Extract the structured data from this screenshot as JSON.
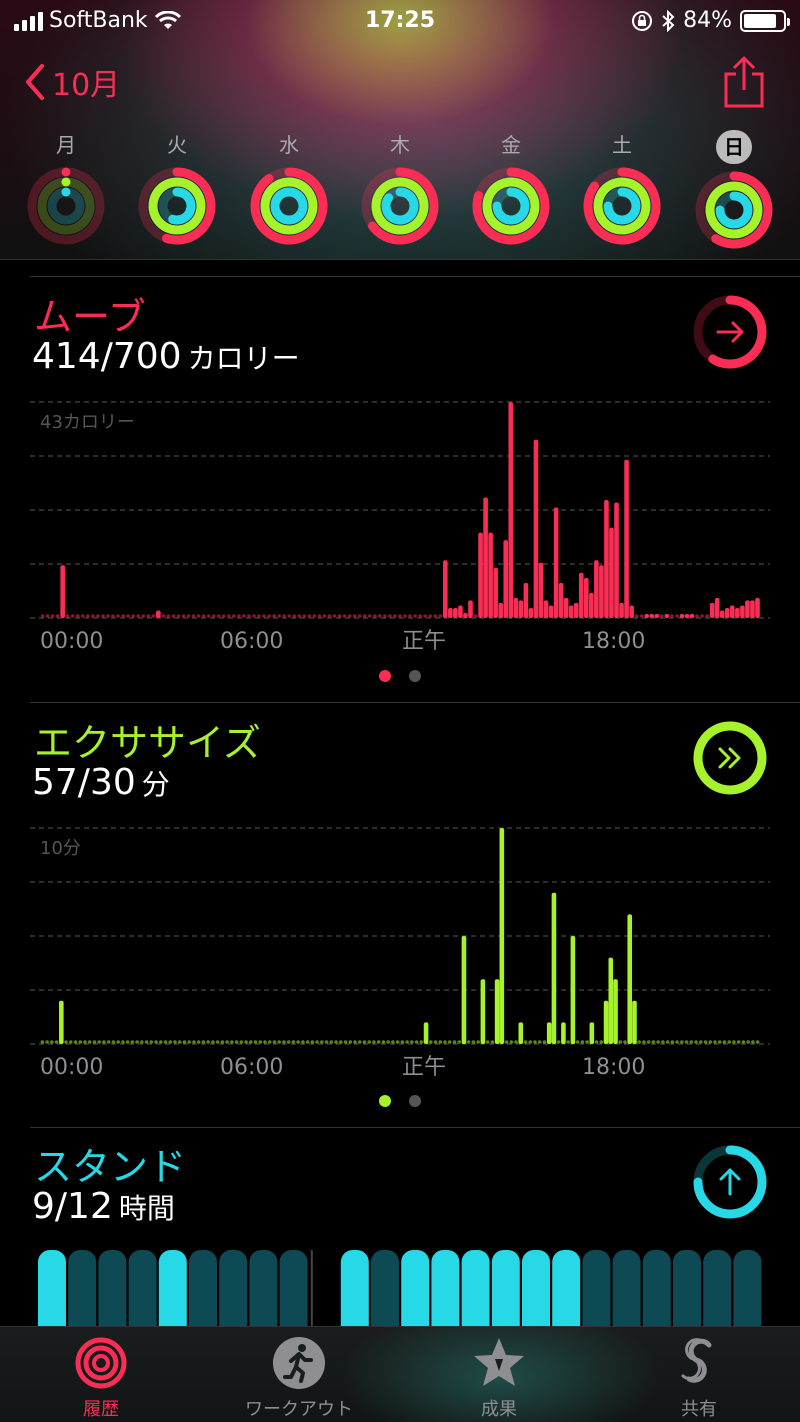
{
  "status": {
    "carrier": "SoftBank",
    "time": "17:25",
    "battery": "84%",
    "battery_level": 0.84
  },
  "nav": {
    "back_label": "10月"
  },
  "week": [
    {
      "label": "月",
      "move": 0.05,
      "exercise": 0.04,
      "stand": 0.06,
      "today": false
    },
    {
      "label": "火",
      "move": 0.55,
      "exercise": 1.0,
      "stand": 0.55,
      "today": false
    },
    {
      "label": "水",
      "move": 0.9,
      "exercise": 1.0,
      "stand": 1.0,
      "today": false
    },
    {
      "label": "木",
      "move": 0.65,
      "exercise": 1.0,
      "stand": 0.85,
      "today": false
    },
    {
      "label": "金",
      "move": 0.8,
      "exercise": 1.0,
      "stand": 0.75,
      "today": false
    },
    {
      "label": "土",
      "move": 0.85,
      "exercise": 1.0,
      "stand": 0.75,
      "today": false
    },
    {
      "label": "日",
      "move": 0.59,
      "exercise": 1.0,
      "stand": 0.75,
      "today": true
    }
  ],
  "colors": {
    "move": "#fa2e55",
    "exercise": "#a6f32c",
    "stand": "#27d8e6"
  },
  "move": {
    "title": "ムーブ",
    "value": "414/700",
    "unit": "カロリー",
    "progress": 0.59,
    "chart_data": {
      "type": "bar",
      "ylabel": "43カロリー",
      "ymax": 43,
      "x_ticks": [
        "00:00",
        "06:00",
        "正午",
        "18:00"
      ],
      "values": [
        0,
        0,
        0,
        0,
        10.5,
        0,
        0,
        0,
        0,
        0,
        0,
        0,
        0,
        0,
        0,
        0,
        0,
        0,
        0,
        0,
        0,
        0,
        0,
        1.5,
        0,
        0,
        0,
        0,
        0,
        0,
        0,
        0,
        0,
        0,
        0,
        0,
        0,
        0,
        0,
        0,
        0,
        0,
        0,
        0,
        0,
        0,
        0,
        0,
        0,
        0,
        0,
        0,
        0,
        0,
        0,
        0,
        0,
        0,
        0,
        0,
        0,
        0,
        0,
        0,
        0,
        0,
        0,
        0,
        0,
        0,
        0,
        0,
        0,
        0,
        0,
        0,
        0,
        0,
        0,
        0,
        11.5,
        2,
        2,
        2.5,
        1,
        3.5,
        0,
        17,
        24,
        17,
        10,
        3,
        15.5,
        43,
        4,
        3.5,
        7,
        2,
        35.5,
        11,
        3.5,
        2.5,
        22,
        7,
        4,
        2.5,
        3,
        9,
        8,
        5,
        11.5,
        10.5,
        23.5,
        18,
        23,
        3,
        31.5,
        2.5,
        0,
        0,
        0.5,
        0.5,
        0.5,
        0,
        0.5,
        0,
        0,
        0.5,
        0.5,
        0.5,
        0,
        0,
        0,
        3,
        4,
        1.5,
        2,
        2.5,
        2,
        2.5,
        3.5,
        3.5,
        4
      ]
    }
  },
  "exercise": {
    "title": "エクササイズ",
    "value": "57/30",
    "unit": "分",
    "progress": 1.0,
    "chart_data": {
      "type": "bar",
      "ylabel": "10分",
      "ymax": 10,
      "x_ticks": [
        "00:00",
        "06:00",
        "正午",
        "18:00"
      ],
      "values": [
        0,
        0,
        0,
        0,
        2,
        0,
        0,
        0,
        0,
        0,
        0,
        0,
        0,
        0,
        0,
        0,
        0,
        0,
        0,
        0,
        0,
        0,
        0,
        0,
        0,
        0,
        0,
        0,
        0,
        0,
        0,
        0,
        0,
        0,
        0,
        0,
        0,
        0,
        0,
        0,
        0,
        0,
        0,
        0,
        0,
        0,
        0,
        0,
        0,
        0,
        0,
        0,
        0,
        0,
        0,
        0,
        0,
        0,
        0,
        0,
        0,
        0,
        0,
        0,
        0,
        0,
        0,
        0,
        0,
        0,
        0,
        0,
        0,
        0,
        0,
        0,
        0,
        0,
        0,
        0,
        0,
        1,
        0,
        0,
        0,
        0,
        0,
        0,
        0,
        5,
        0,
        0,
        0,
        3,
        0,
        0,
        3,
        10,
        0,
        0,
        0,
        1,
        0,
        0,
        0,
        0,
        0,
        1,
        7,
        0,
        1,
        0,
        5,
        0,
        0,
        0,
        1,
        0,
        0,
        2,
        4,
        3,
        0,
        0,
        6,
        2,
        0,
        0,
        0,
        0,
        0,
        0,
        0,
        0,
        0,
        0,
        0,
        0,
        0,
        0,
        0,
        0,
        0,
        0,
        0,
        0,
        0,
        0,
        0,
        0,
        0,
        0
      ]
    }
  },
  "stand": {
    "title": "スタンド",
    "value": "9/12",
    "unit": "時間",
    "progress": 0.75,
    "chart_data": {
      "type": "bar",
      "hours": [
        1,
        0,
        0,
        0,
        1,
        0,
        0,
        0,
        0,
        -1,
        1,
        0,
        1,
        1,
        1,
        1,
        1,
        1,
        0,
        0,
        0,
        0,
        0,
        0
      ]
    }
  },
  "tabs": [
    {
      "label": "履歴",
      "icon": "rings-icon",
      "active": true
    },
    {
      "label": "ワークアウト",
      "icon": "runner-icon",
      "active": false
    },
    {
      "label": "成果",
      "icon": "star-icon",
      "active": false
    },
    {
      "label": "共有",
      "icon": "share-s-icon",
      "active": false
    }
  ]
}
